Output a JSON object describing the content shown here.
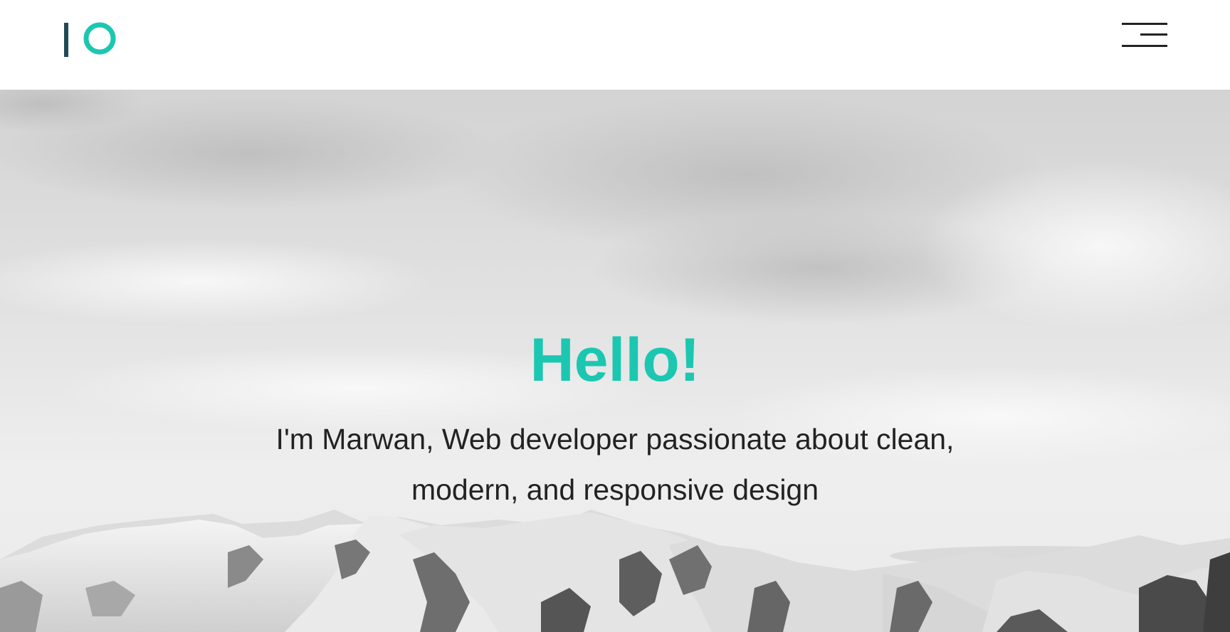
{
  "brand": {
    "logo_icon": "io-logo-icon",
    "colors": {
      "bar": "#1f4a57",
      "ring": "#1cc7b1"
    }
  },
  "nav": {
    "menu_icon": "hamburger-menu-icon"
  },
  "hero": {
    "title": "Hello!",
    "subtitle": "I'm Marwan, Web developer passionate about clean, modern, and responsive design",
    "background": "snowy-mountains-cloudy-sky-image"
  },
  "colors": {
    "accent": "#1cc7b1",
    "text": "#222222",
    "header_bg": "#ffffff",
    "menu_lines": "#222222"
  }
}
